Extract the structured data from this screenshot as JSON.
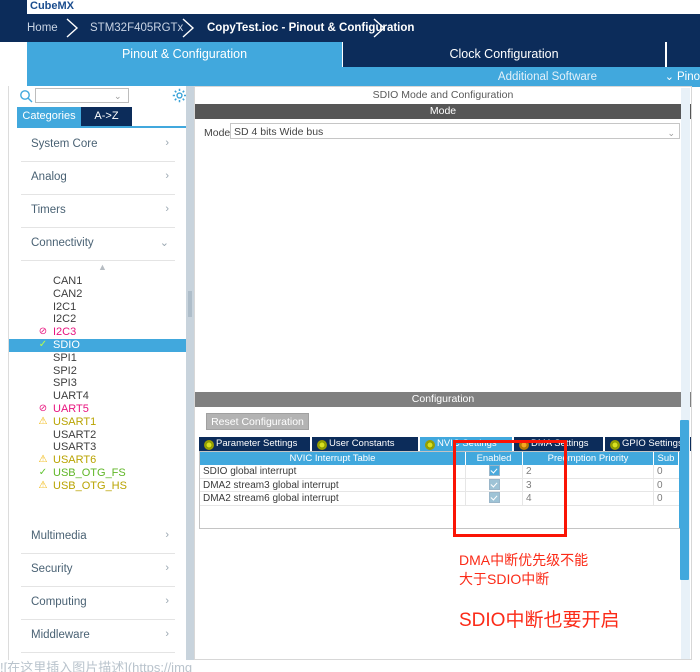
{
  "app": {
    "logo": "CubeMX"
  },
  "breadcrumb": {
    "items": [
      {
        "label": "Home",
        "style": "dim"
      },
      {
        "label": "STM32F405RGTx",
        "style": "dim"
      },
      {
        "label": "CopyTest.ioc - Pinout & Configuration",
        "style": "bold"
      }
    ]
  },
  "main_tabs": [
    {
      "label": "Pinout & Configuration",
      "active": true
    },
    {
      "label": "Clock Configuration",
      "active": false
    }
  ],
  "subbar": {
    "additional_software": "Additional Software",
    "pinout_link": "Pino",
    "chevron": "⌄"
  },
  "sidebar": {
    "search": {
      "value": "",
      "placeholder": "",
      "caret": "⌄"
    },
    "tabs": [
      {
        "label": "Categories",
        "active": true
      },
      {
        "label": "A->Z",
        "active": false
      }
    ],
    "groups": [
      {
        "label": "System Core",
        "chevron": "›",
        "expanded": false
      },
      {
        "label": "Analog",
        "chevron": "›",
        "expanded": false
      },
      {
        "label": "Timers",
        "chevron": "›",
        "expanded": false
      },
      {
        "label": "Connectivity",
        "chevron": "⌄",
        "expanded": true
      }
    ],
    "groups_bottom": [
      {
        "label": "Multimedia",
        "chevron": "›"
      },
      {
        "label": "Security",
        "chevron": "›"
      },
      {
        "label": "Computing",
        "chevron": "›"
      },
      {
        "label": "Middleware",
        "chevron": "›"
      }
    ],
    "connectivity_items": [
      {
        "label": "CAN1",
        "badge": "",
        "state": "none"
      },
      {
        "label": "CAN2",
        "badge": "",
        "state": "none"
      },
      {
        "label": "I2C1",
        "badge": "",
        "state": "none"
      },
      {
        "label": "I2C2",
        "badge": "",
        "state": "none"
      },
      {
        "label": "I2C3",
        "badge": "⊘",
        "state": "err"
      },
      {
        "label": "SDIO",
        "badge": "✓",
        "state": "selected"
      },
      {
        "label": "SPI1",
        "badge": "",
        "state": "none"
      },
      {
        "label": "SPI2",
        "badge": "",
        "state": "none"
      },
      {
        "label": "SPI3",
        "badge": "",
        "state": "none"
      },
      {
        "label": "UART4",
        "badge": "",
        "state": "none"
      },
      {
        "label": "UART5",
        "badge": "⊘",
        "state": "err"
      },
      {
        "label": "USART1",
        "badge": "⚠",
        "state": "warn"
      },
      {
        "label": "USART2",
        "badge": "",
        "state": "none"
      },
      {
        "label": "USART3",
        "badge": "",
        "state": "none"
      },
      {
        "label": "USART6",
        "badge": "⚠",
        "state": "warn"
      },
      {
        "label": "USB_OTG_FS",
        "badge": "✓",
        "state": "ok"
      },
      {
        "label": "USB_OTG_HS",
        "badge": "⚠",
        "state": "warn"
      }
    ]
  },
  "panel": {
    "title": "SDIO Mode and Configuration",
    "mode_section": {
      "header": "Mode",
      "mode_label": "Mode",
      "mode_value": "SD 4 bits Wide bus",
      "caret": "⌄"
    },
    "config_section": {
      "header": "Configuration",
      "reset_button": "Reset Configuration",
      "tabs": [
        {
          "label": "Parameter Settings",
          "active": false,
          "dot": "yellow"
        },
        {
          "label": "User Constants",
          "active": false,
          "dot": "yellow"
        },
        {
          "label": "NVIC Settings",
          "active": true,
          "dot": "yellow"
        },
        {
          "label": "DMA Settings",
          "active": false,
          "dot": "amber"
        },
        {
          "label": "GPIO Settings",
          "active": false,
          "dot": "yellow"
        }
      ],
      "table": {
        "columns": [
          "NVIC Interrupt Table",
          "Enabled",
          "Preemption Priority",
          "Sub Priority"
        ],
        "rows": [
          {
            "name": "SDIO global interrupt",
            "enabled": true,
            "preemption": "2",
            "sub": "0",
            "dimmed": false
          },
          {
            "name": "DMA2 stream3 global interrupt",
            "enabled": true,
            "preemption": "3",
            "sub": "0",
            "dimmed": true
          },
          {
            "name": "DMA2 stream6 global interrupt",
            "enabled": true,
            "preemption": "4",
            "sub": "0",
            "dimmed": true
          }
        ]
      }
    }
  },
  "annotations": {
    "line1": "DMA中断优先级不能",
    "line2": "大于SDIO中断",
    "line3": "SDIO中断也要开启"
  },
  "footer": {
    "watermark": "![在这里插入图片描述](https://img"
  },
  "colors": {
    "navy": "#0c2c5a",
    "accent_blue": "#41a8dd",
    "annotation_red": "#fb2a17",
    "warn_yellow": "#f0b400",
    "error_pink": "#e8127e",
    "ok_green": "#61c431"
  }
}
